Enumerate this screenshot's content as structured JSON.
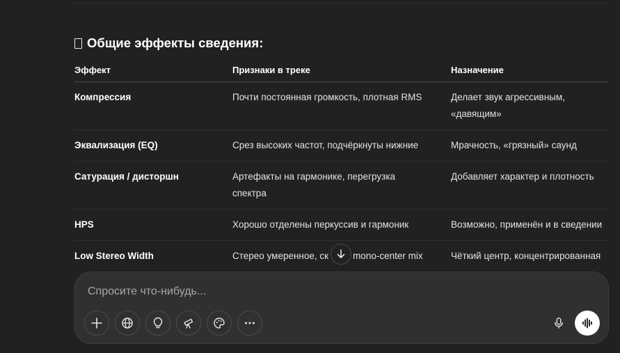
{
  "section": {
    "title": "Общие эффекты сведения:"
  },
  "table": {
    "headers": [
      "Эффект",
      "Признаки в треке",
      "Назначение"
    ],
    "rows": [
      {
        "effect": "Компрессия",
        "signs": "Почти постоянная громкость, плотная RMS",
        "purpose": "Делает звук агрессивным, «давящим»"
      },
      {
        "effect": "Эквализация (EQ)",
        "signs": "Срез высоких частот, подчёркнуты нижние",
        "purpose": "Мрачность, «грязный» саунд"
      },
      {
        "effect": "Сатурация / дисторшн",
        "signs": "Артефакты на гармонике, перегрузка спектра",
        "purpose": "Добавляет характер и плотность"
      },
      {
        "effect": "HPS",
        "signs": "Хорошо отделены перкуссив и гармоник",
        "purpose": "Возможно, применён и в сведении"
      },
      {
        "effect": "Low Stereo Width",
        "signs": "Стерео умеренное, ск",
        "signs_after_button": "mono-center mix",
        "purpose": "Чёткий центр, концентрированная"
      }
    ]
  },
  "composer": {
    "placeholder": "Спросите что-нибудь..."
  },
  "icons": {
    "section_glyph": "missing-glyph-icon",
    "scroll_down": "arrow-down-icon",
    "add": "plus-icon",
    "web_search": "globe-icon",
    "think": "lightbulb-icon",
    "deep_research": "telescope-icon",
    "create_image": "palette-icon",
    "more": "ellipsis-icon",
    "dictate": "microphone-icon",
    "voice_mode": "voice-waveform-icon"
  },
  "colors": {
    "background": "#212121",
    "composer": "#303030",
    "text": "#ececec",
    "voice_button": "#ffffff"
  }
}
